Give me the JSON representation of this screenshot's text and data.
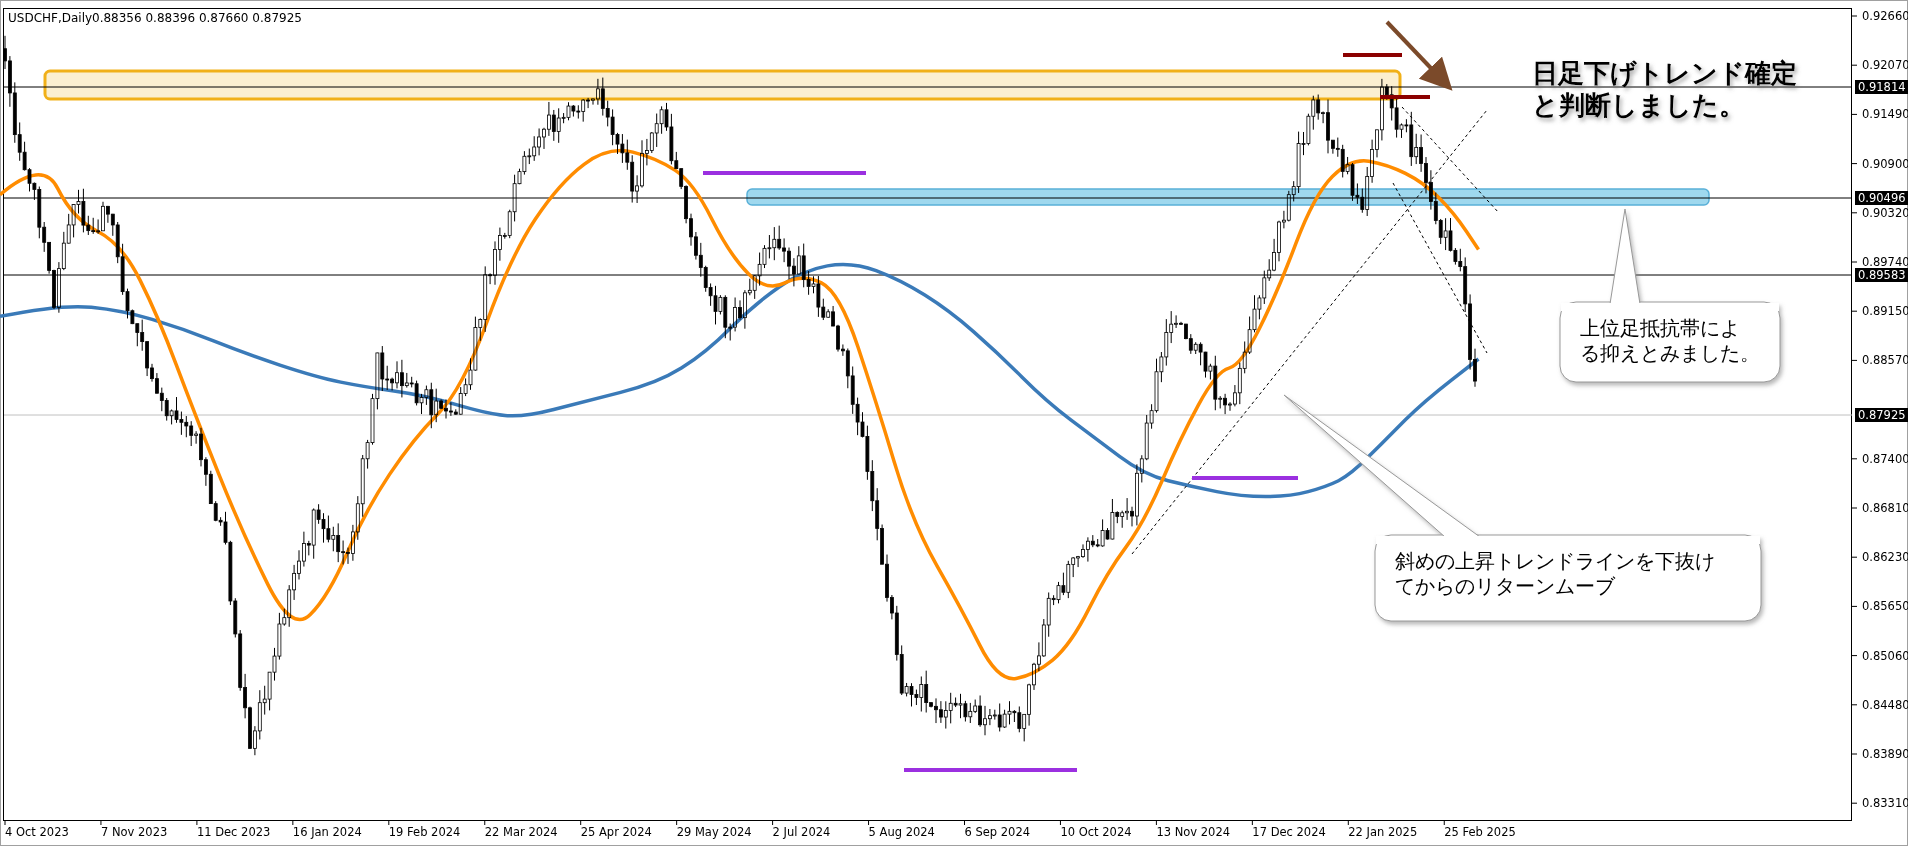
{
  "chart": {
    "title": "USDCHF,Daily",
    "ohlc": "0.88356 0.88396 0.87660 0.87925",
    "y_axis_labels": [
      "0.92660",
      "0.92070",
      "0.91490",
      "0.90900",
      "0.90320",
      "0.89740",
      "0.89150",
      "0.88570",
      "0.87400",
      "0.86810",
      "0.86230",
      "0.85650",
      "0.85060",
      "0.84480",
      "0.83890",
      "0.83310"
    ],
    "price_labels": [
      "0.91814",
      "0.90496",
      "0.89583",
      "0.87925"
    ],
    "x_axis_labels": [
      "4 Oct 2023",
      "7 Nov 2023",
      "11 Dec 2023",
      "16 Jan 2024",
      "19 Feb 2024",
      "22 Mar 2024",
      "25 Apr 2024",
      "29 May 2024",
      "2 Jul 2024",
      "5 Aug 2024",
      "6 Sep 2024",
      "10 Oct 2024",
      "13 Nov 2024",
      "17 Dec 2024",
      "22 Jan 2025",
      "25 Feb 2025"
    ]
  },
  "annotations": [
    {
      "kind": "heading",
      "lines": [
        "日足下げトレンド確定",
        "と判断しました。"
      ]
    },
    {
      "kind": "callout",
      "lines": [
        "上位足抵抗帯によ",
        "る抑えとみました。"
      ]
    },
    {
      "kind": "callout",
      "lines": [
        "斜めの上昇トレンドラインを下抜け",
        "てからのリターンムーブ"
      ]
    }
  ]
}
